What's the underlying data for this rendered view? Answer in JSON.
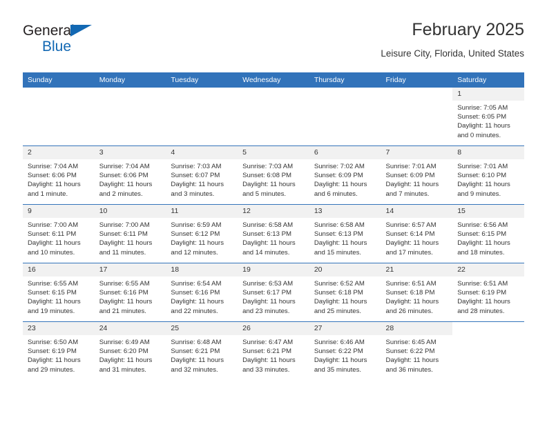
{
  "brand": {
    "name_top": "General",
    "name_bottom": "Blue",
    "triangle_color": "#1268b3"
  },
  "header": {
    "title": "February 2025",
    "subtitle": "Leisure City, Florida, United States"
  },
  "theme": {
    "header_blue": "#3273ba",
    "daynum_band": "#f1f1f1",
    "text": "#333333"
  },
  "calendar": {
    "weekday_headers": [
      "Sunday",
      "Monday",
      "Tuesday",
      "Wednesday",
      "Thursday",
      "Friday",
      "Saturday"
    ],
    "labels": {
      "sunrise": "Sunrise:",
      "sunset": "Sunset:",
      "daylight": "Daylight:"
    },
    "weeks": [
      [
        {
          "day": "",
          "blank": true
        },
        {
          "day": "",
          "blank": true
        },
        {
          "day": "",
          "blank": true
        },
        {
          "day": "",
          "blank": true
        },
        {
          "day": "",
          "blank": true
        },
        {
          "day": "",
          "blank": true
        },
        {
          "day": "1",
          "sunrise": "Sunrise: 7:05 AM",
          "sunset": "Sunset: 6:05 PM",
          "daylight1": "Daylight: 11 hours",
          "daylight2": "and 0 minutes."
        }
      ],
      [
        {
          "day": "2",
          "sunrise": "Sunrise: 7:04 AM",
          "sunset": "Sunset: 6:06 PM",
          "daylight1": "Daylight: 11 hours",
          "daylight2": "and 1 minute."
        },
        {
          "day": "3",
          "sunrise": "Sunrise: 7:04 AM",
          "sunset": "Sunset: 6:06 PM",
          "daylight1": "Daylight: 11 hours",
          "daylight2": "and 2 minutes."
        },
        {
          "day": "4",
          "sunrise": "Sunrise: 7:03 AM",
          "sunset": "Sunset: 6:07 PM",
          "daylight1": "Daylight: 11 hours",
          "daylight2": "and 3 minutes."
        },
        {
          "day": "5",
          "sunrise": "Sunrise: 7:03 AM",
          "sunset": "Sunset: 6:08 PM",
          "daylight1": "Daylight: 11 hours",
          "daylight2": "and 5 minutes."
        },
        {
          "day": "6",
          "sunrise": "Sunrise: 7:02 AM",
          "sunset": "Sunset: 6:09 PM",
          "daylight1": "Daylight: 11 hours",
          "daylight2": "and 6 minutes."
        },
        {
          "day": "7",
          "sunrise": "Sunrise: 7:01 AM",
          "sunset": "Sunset: 6:09 PM",
          "daylight1": "Daylight: 11 hours",
          "daylight2": "and 7 minutes."
        },
        {
          "day": "8",
          "sunrise": "Sunrise: 7:01 AM",
          "sunset": "Sunset: 6:10 PM",
          "daylight1": "Daylight: 11 hours",
          "daylight2": "and 9 minutes."
        }
      ],
      [
        {
          "day": "9",
          "sunrise": "Sunrise: 7:00 AM",
          "sunset": "Sunset: 6:11 PM",
          "daylight1": "Daylight: 11 hours",
          "daylight2": "and 10 minutes."
        },
        {
          "day": "10",
          "sunrise": "Sunrise: 7:00 AM",
          "sunset": "Sunset: 6:11 PM",
          "daylight1": "Daylight: 11 hours",
          "daylight2": "and 11 minutes."
        },
        {
          "day": "11",
          "sunrise": "Sunrise: 6:59 AM",
          "sunset": "Sunset: 6:12 PM",
          "daylight1": "Daylight: 11 hours",
          "daylight2": "and 12 minutes."
        },
        {
          "day": "12",
          "sunrise": "Sunrise: 6:58 AM",
          "sunset": "Sunset: 6:13 PM",
          "daylight1": "Daylight: 11 hours",
          "daylight2": "and 14 minutes."
        },
        {
          "day": "13",
          "sunrise": "Sunrise: 6:58 AM",
          "sunset": "Sunset: 6:13 PM",
          "daylight1": "Daylight: 11 hours",
          "daylight2": "and 15 minutes."
        },
        {
          "day": "14",
          "sunrise": "Sunrise: 6:57 AM",
          "sunset": "Sunset: 6:14 PM",
          "daylight1": "Daylight: 11 hours",
          "daylight2": "and 17 minutes."
        },
        {
          "day": "15",
          "sunrise": "Sunrise: 6:56 AM",
          "sunset": "Sunset: 6:15 PM",
          "daylight1": "Daylight: 11 hours",
          "daylight2": "and 18 minutes."
        }
      ],
      [
        {
          "day": "16",
          "sunrise": "Sunrise: 6:55 AM",
          "sunset": "Sunset: 6:15 PM",
          "daylight1": "Daylight: 11 hours",
          "daylight2": "and 19 minutes."
        },
        {
          "day": "17",
          "sunrise": "Sunrise: 6:55 AM",
          "sunset": "Sunset: 6:16 PM",
          "daylight1": "Daylight: 11 hours",
          "daylight2": "and 21 minutes."
        },
        {
          "day": "18",
          "sunrise": "Sunrise: 6:54 AM",
          "sunset": "Sunset: 6:16 PM",
          "daylight1": "Daylight: 11 hours",
          "daylight2": "and 22 minutes."
        },
        {
          "day": "19",
          "sunrise": "Sunrise: 6:53 AM",
          "sunset": "Sunset: 6:17 PM",
          "daylight1": "Daylight: 11 hours",
          "daylight2": "and 23 minutes."
        },
        {
          "day": "20",
          "sunrise": "Sunrise: 6:52 AM",
          "sunset": "Sunset: 6:18 PM",
          "daylight1": "Daylight: 11 hours",
          "daylight2": "and 25 minutes."
        },
        {
          "day": "21",
          "sunrise": "Sunrise: 6:51 AM",
          "sunset": "Sunset: 6:18 PM",
          "daylight1": "Daylight: 11 hours",
          "daylight2": "and 26 minutes."
        },
        {
          "day": "22",
          "sunrise": "Sunrise: 6:51 AM",
          "sunset": "Sunset: 6:19 PM",
          "daylight1": "Daylight: 11 hours",
          "daylight2": "and 28 minutes."
        }
      ],
      [
        {
          "day": "23",
          "sunrise": "Sunrise: 6:50 AM",
          "sunset": "Sunset: 6:19 PM",
          "daylight1": "Daylight: 11 hours",
          "daylight2": "and 29 minutes."
        },
        {
          "day": "24",
          "sunrise": "Sunrise: 6:49 AM",
          "sunset": "Sunset: 6:20 PM",
          "daylight1": "Daylight: 11 hours",
          "daylight2": "and 31 minutes."
        },
        {
          "day": "25",
          "sunrise": "Sunrise: 6:48 AM",
          "sunset": "Sunset: 6:21 PM",
          "daylight1": "Daylight: 11 hours",
          "daylight2": "and 32 minutes."
        },
        {
          "day": "26",
          "sunrise": "Sunrise: 6:47 AM",
          "sunset": "Sunset: 6:21 PM",
          "daylight1": "Daylight: 11 hours",
          "daylight2": "and 33 minutes."
        },
        {
          "day": "27",
          "sunrise": "Sunrise: 6:46 AM",
          "sunset": "Sunset: 6:22 PM",
          "daylight1": "Daylight: 11 hours",
          "daylight2": "and 35 minutes."
        },
        {
          "day": "28",
          "sunrise": "Sunrise: 6:45 AM",
          "sunset": "Sunset: 6:22 PM",
          "daylight1": "Daylight: 11 hours",
          "daylight2": "and 36 minutes."
        },
        {
          "day": "",
          "blank": true
        }
      ]
    ]
  }
}
